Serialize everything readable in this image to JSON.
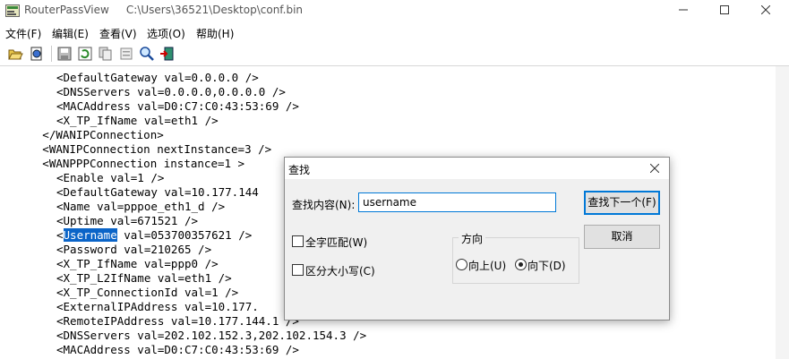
{
  "window": {
    "app_name": "RouterPassView",
    "file_path": "C:\\Users\\36521\\Desktop\\conf.bin"
  },
  "menu": [
    "文件(F)",
    "编辑(E)",
    "查看(V)",
    "选项(O)",
    "帮助(H)"
  ],
  "toolbar": [
    "open-folder-icon",
    "open-file-icon",
    "save-icon",
    "refresh-icon",
    "copy-icon",
    "properties-icon",
    "find-icon",
    "exit-icon"
  ],
  "code_lines": [
    {
      "indent": 5,
      "text": "<DefaultGateway val=0.0.0.0 />"
    },
    {
      "indent": 5,
      "text": "<DNSServers val=0.0.0.0,0.0.0.0 />"
    },
    {
      "indent": 5,
      "text": "<MACAddress val=D0:C7:C0:43:53:69 />"
    },
    {
      "indent": 5,
      "text": "<X_TP_IfName val=eth1 />"
    },
    {
      "indent": 4,
      "text": "</WANIPConnection>"
    },
    {
      "indent": 4,
      "text": "<WANIPConnection nextInstance=3 />"
    },
    {
      "indent": 4,
      "text": "<WANPPPConnection instance=1 >"
    },
    {
      "indent": 5,
      "text": "<Enable val=1 />"
    },
    {
      "indent": 5,
      "text": "<DefaultGateway val=10.177.144"
    },
    {
      "indent": 5,
      "text": "<Name val=pppoe_eth1_d />"
    },
    {
      "indent": 5,
      "text": "<Uptime val=671521 />"
    },
    {
      "indent": 5,
      "pre": "<",
      "hl": "Username",
      "text": " val=053700357621 />"
    },
    {
      "indent": 5,
      "text": "<Password val=210265 />"
    },
    {
      "indent": 5,
      "text": "<X_TP_IfName val=ppp0 />"
    },
    {
      "indent": 5,
      "text": "<X_TP_L2IfName val=eth1 />"
    },
    {
      "indent": 5,
      "text": "<X_TP_ConnectionId val=1 />"
    },
    {
      "indent": 5,
      "text": "<ExternalIPAddress val=10.177."
    },
    {
      "indent": 5,
      "text": "<RemoteIPAddress val=10.177.144.1 />"
    },
    {
      "indent": 5,
      "text": "<DNSServers val=202.102.152.3,202.102.154.3 />"
    },
    {
      "indent": 5,
      "text": "<MACAddress val=D0:C7:C0:43:53:69 />"
    }
  ],
  "find_dialog": {
    "title": "查找",
    "find_label": "查找内容(N):",
    "find_value": "username",
    "find_next_label": "查找下一个(F)",
    "cancel_label": "取消",
    "whole_word_label": "全字匹配(W)",
    "match_case_label": "区分大小写(C)",
    "whole_word_checked": false,
    "match_case_checked": false,
    "direction_title": "方向",
    "up_label": "向上(U)",
    "down_label": "向下(D)",
    "direction_selected": "down"
  }
}
